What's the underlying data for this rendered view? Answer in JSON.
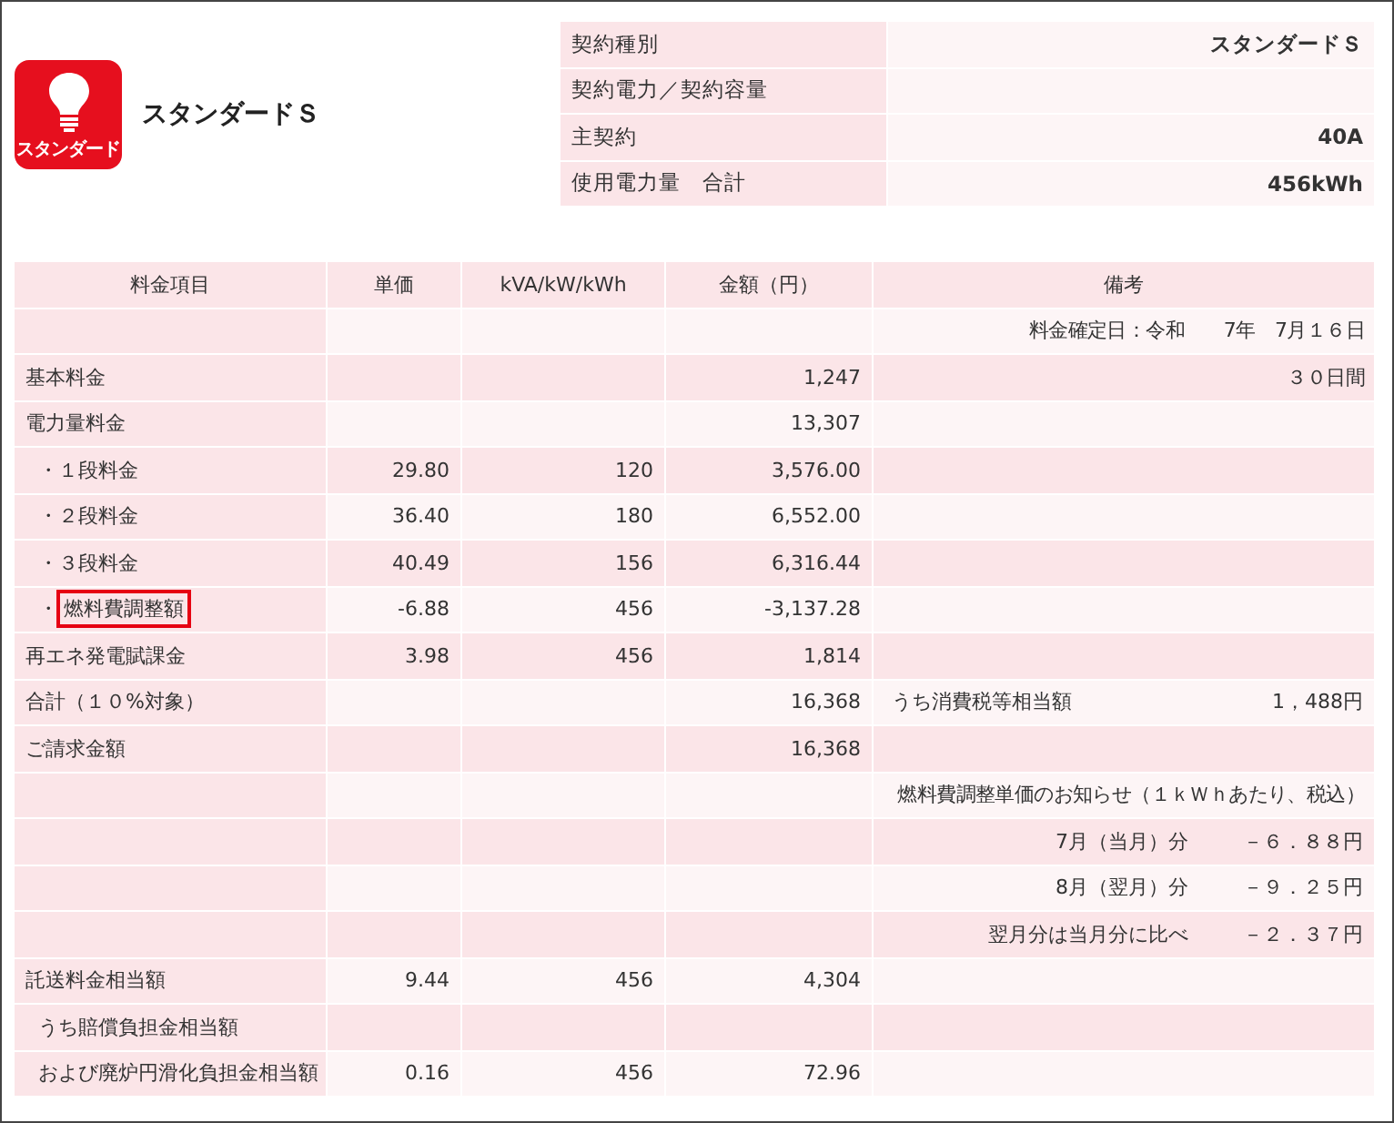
{
  "plan": {
    "logo_label": "スタンダード",
    "title": "スタンダードＳ"
  },
  "contract": [
    {
      "label": "契約種別",
      "value": "スタンダードＳ"
    },
    {
      "label": "契約電力／契約容量"
    },
    {
      "label": "主契約",
      "value": "40A"
    },
    {
      "label": "使用電力量　合計",
      "value": "456kWh"
    }
  ],
  "table": {
    "columns": [
      "料金項目",
      "単価",
      "kVA/kW/kWh",
      "金額（円）",
      "備考"
    ],
    "rows": [
      {
        "kind": "main",
        "note": {
          "kind": "single",
          "value": "料金確定日：令和　　7年　7月１６日"
        }
      },
      {
        "kind": "main",
        "item": "基本料金",
        "amount": "1,247",
        "note": {
          "kind": "single",
          "value": "３０日間"
        }
      },
      {
        "kind": "main",
        "item": "電力量料金",
        "amount": "13,307"
      },
      {
        "kind": "sub",
        "bullet": "・",
        "item": "１段料金",
        "unit_price": "29.80",
        "quantity": "120",
        "amount": "3,576.00"
      },
      {
        "kind": "sub",
        "bullet": "・",
        "item": "２段料金",
        "unit_price": "36.40",
        "quantity": "180",
        "amount": "6,552.00"
      },
      {
        "kind": "sub",
        "bullet": "・",
        "item": "３段料金",
        "unit_price": "40.49",
        "quantity": "156",
        "amount": "6,316.44"
      },
      {
        "kind": "sub",
        "bullet": "・",
        "item": "燃料費調整額",
        "highlighted": true,
        "unit_price": "-6.88",
        "quantity": "456",
        "amount": "-3,137.28"
      },
      {
        "kind": "main",
        "item": "再エネ発電賦課金",
        "unit_price": "3.98",
        "quantity": "456",
        "amount": "1,814"
      },
      {
        "kind": "main",
        "item": "合計（１０%対象）",
        "amount": "16,368",
        "note": {
          "kind": "split",
          "label": "うち消費税等相当額",
          "value": "1，488円"
        }
      },
      {
        "kind": "main",
        "item": "ご請求金額",
        "amount": "16,368"
      },
      {
        "kind": "main",
        "note": {
          "kind": "single",
          "value": "燃料費調整単価のお知らせ（１ｋＷｈあたり、税込）"
        }
      },
      {
        "kind": "main",
        "note": {
          "kind": "pair",
          "label": "7月（当月）分",
          "value": "－６．８８円"
        }
      },
      {
        "kind": "main",
        "note": {
          "kind": "pair",
          "label": "8月（翌月）分",
          "value": "－９．２５円"
        }
      },
      {
        "kind": "main",
        "note": {
          "kind": "pair",
          "label": "翌月分は当月分に比べ",
          "value": "－２．３７円"
        }
      },
      {
        "kind": "main",
        "item": "託送料金相当額",
        "unit_price": "9.44",
        "quantity": "456",
        "amount": "4,304"
      },
      {
        "kind": "sub",
        "item": "うち賠償負担金相当額"
      },
      {
        "kind": "sub",
        "item": "および廃炉円滑化負担金相当額",
        "unit_price": "0.16",
        "quantity": "456",
        "amount": "72.96"
      }
    ]
  }
}
